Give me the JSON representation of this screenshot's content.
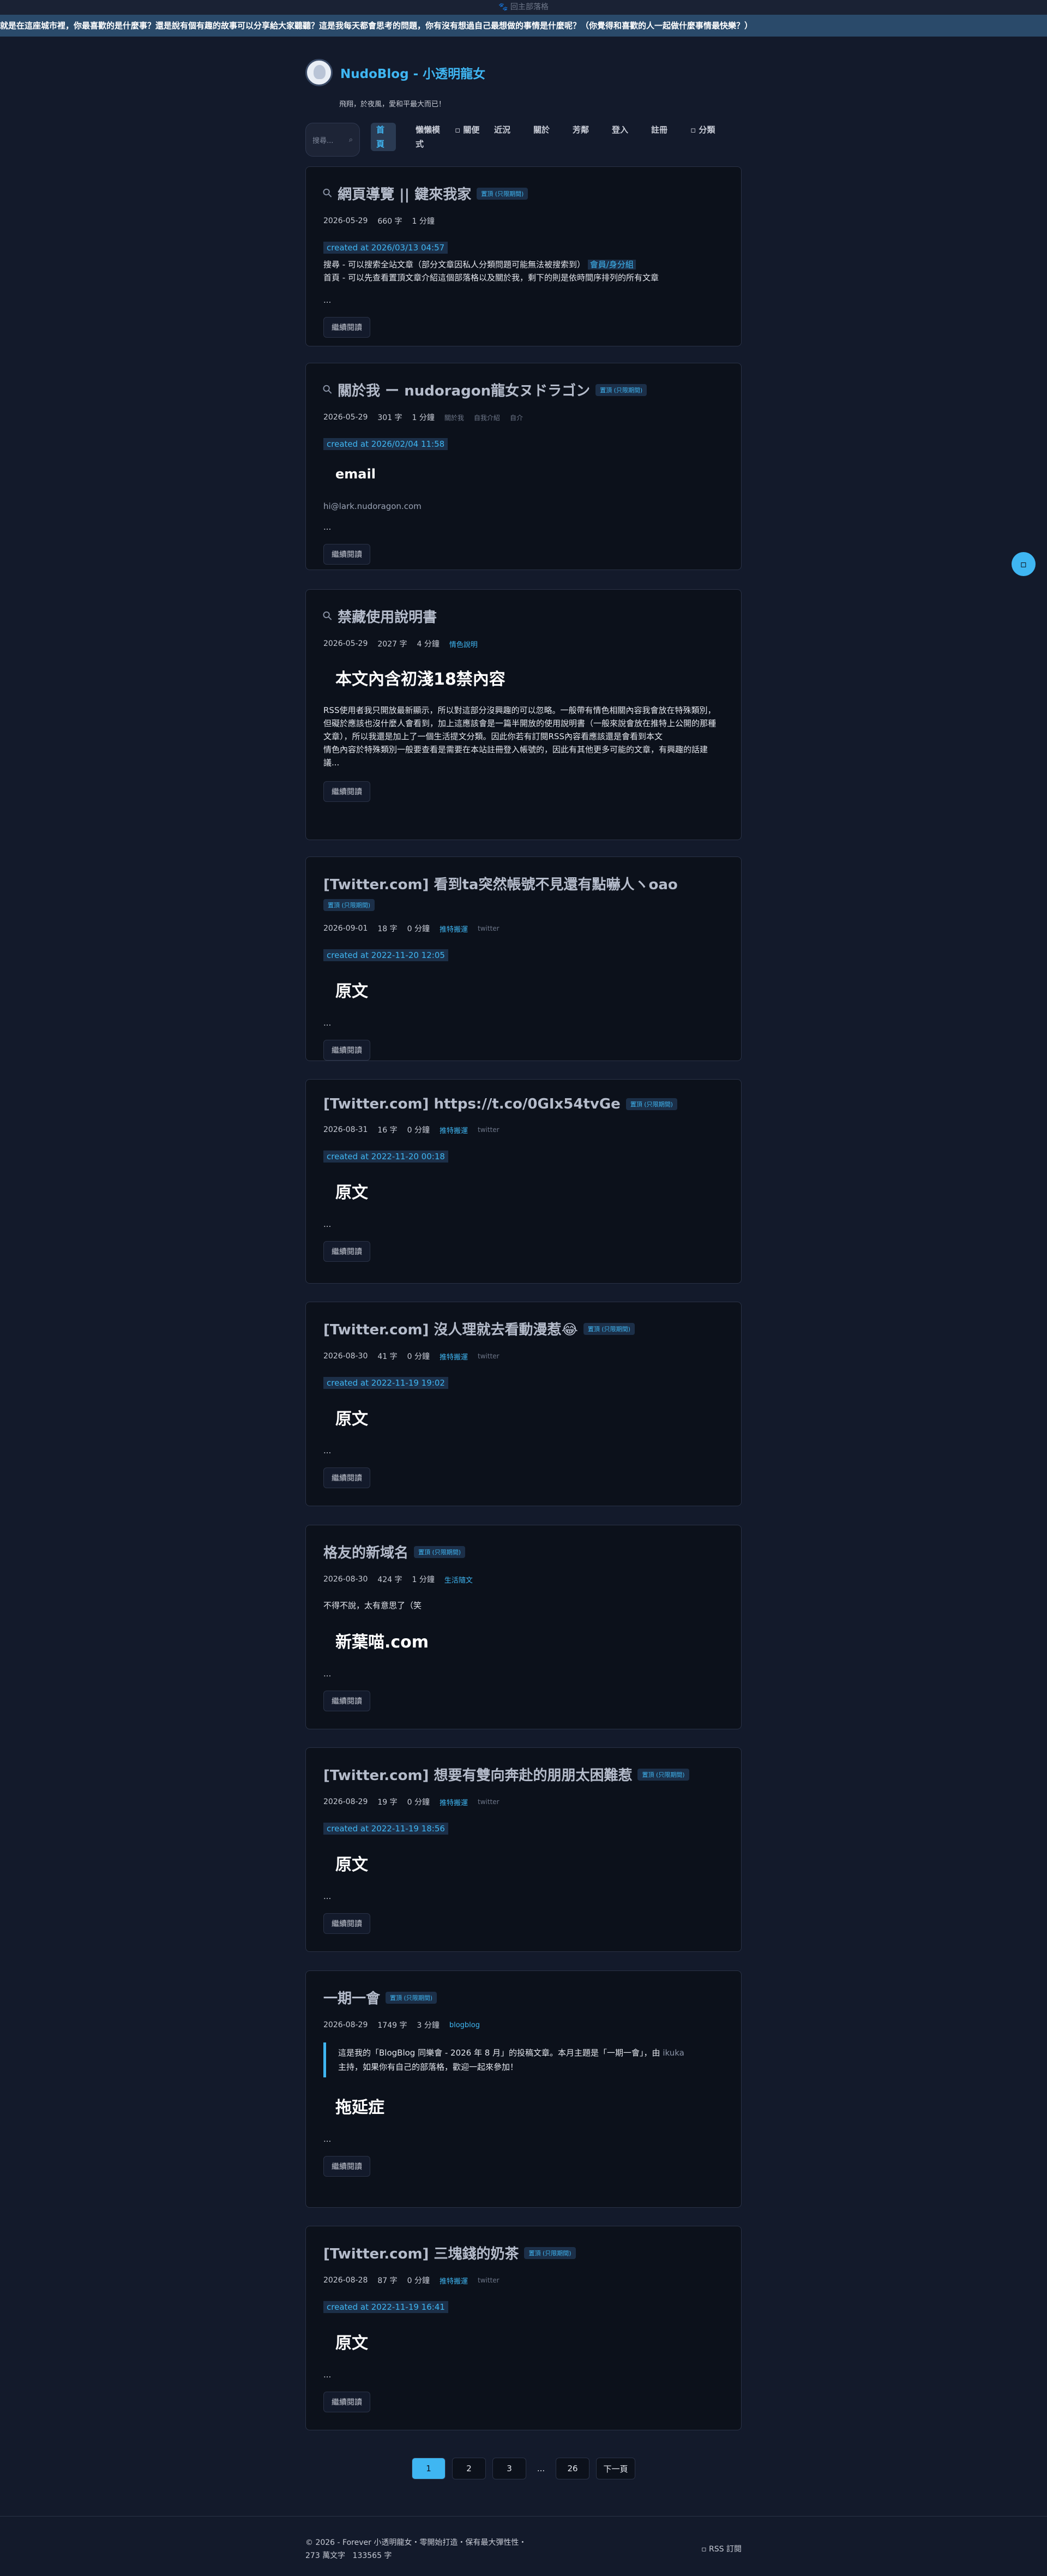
{
  "topbar": {
    "text": "🐾 回主部落格"
  },
  "marquee": {
    "text": "就是在這座城市裡，你最喜歡的是什麼事？還是說有個有趣的故事可以分享給大家聽聽？這是我每天都會思考的問題，你有沒有想過自己最想做的事情是什麼呢？（你覺得和喜歡的人一起做什麼事情最快樂？）"
  },
  "header": {
    "title": "NudoBlog - 小透明龍女",
    "tagline": "飛翔，於夜風，愛和平最大而已！",
    "search_placeholder": "搜尋...",
    "nav": [
      "首頁",
      "懶懶模式",
      "關便",
      "近況",
      "關於",
      "芳鄰",
      "登入",
      "註冊",
      "分類"
    ]
  },
  "posts": [
    {
      "title": "網頁導覽 || 鍵來我家",
      "badge": "置頂 (只限期間)",
      "date": "2026-05-29",
      "words": "660 字",
      "read": "1 分鐘",
      "created": "created at 2026/03/13 04:57",
      "line1": "搜尋 - 可以搜索全站文章（部分文章因私人分類問題可能無法被搜索到）",
      "hl": "會員/身分組",
      "line2": "首頁 - 可以先查看置頂文章介紹這個部落格以及關於我，剩下的則是依時間序排列的所有文章",
      "dots": "...",
      "more": "繼續閱讀"
    },
    {
      "title": "關於我 ー nudoragon龍女ヌドラゴン",
      "badge": "置頂 (只限期間)",
      "date": "2026-05-29",
      "words": "301 字",
      "read": "1 分鐘",
      "tags": [
        "關於我",
        "自我介紹",
        "自介"
      ],
      "created": "created at 2026/02/04 11:58",
      "heading": "email",
      "sub": "hi@lark.nudoragon.com",
      "dots": "...",
      "more": "繼續閱讀"
    },
    {
      "title": "禁藏使用說明書",
      "date": "2026-05-29",
      "words": "2027 字",
      "read": "4 分鐘",
      "tag": "情色說明",
      "heading": "本文內含初淺18禁內容",
      "body": "RSS使用者我只開放最新顯示，所以對這部分沒興趣的可以忽略。一般帶有情色相關內容我會放在特殊類別，但礙於應該也沒什麼人會看到，加上這應該會是一篇半開放的使用說明書（一般來說會放在推特上公開的那種文章），所以我還是加上了一個生活提文分類。因此你若有訂閱RSS內容看應該還是會看到本文",
      "body2": "情色內容於特殊類別一般要查看是需要在本站註冊登入帳號的，因此有其他更多可能的文章，有興趣的話建議...",
      "more": "繼續閱讀"
    },
    {
      "title": "[Twitter.com] 看到ta突然帳號不見還有點嚇人ヽoao",
      "badge": "置頂 (只限期間)",
      "date": "2026-09-01",
      "words": "18 字",
      "read": "0 分鐘",
      "tag": "推特搬運",
      "tag2": "twitter",
      "created": "created at 2022-11-20 12:05",
      "heading": "原文",
      "dots": "...",
      "more": "繼續閱讀"
    },
    {
      "title": "[Twitter.com] https://t.co/0GIx54tvGe",
      "badge": "置頂 (只限期間)",
      "date": "2026-08-31",
      "words": "16 字",
      "read": "0 分鐘",
      "tag": "推特搬運",
      "tag2": "twitter",
      "created": "created at 2022-11-20 00:18",
      "heading": "原文",
      "dots": "...",
      "more": "繼續閱讀"
    },
    {
      "title": "[Twitter.com] 沒人理就去看動漫惹😂",
      "badge": "置頂 (只限期間)",
      "date": "2026-08-30",
      "words": "41 字",
      "read": "0 分鐘",
      "tag": "推特搬運",
      "tag2": "twitter",
      "created": "created at 2022-11-19 19:02",
      "heading": "原文",
      "dots": "...",
      "more": "繼續閱讀"
    },
    {
      "title": "格友的新域名",
      "badge": "置頂 (只限期間)",
      "date": "2026-08-30",
      "words": "424 字",
      "read": "1 分鐘",
      "tag": "生活隨文",
      "line1": "不得不說，太有意思了（笑",
      "heading": "新葉喵.com",
      "dots": "...",
      "more": "繼續閱讀"
    },
    {
      "title": "[Twitter.com] 想要有雙向奔赴的朋朋太困難惹",
      "badge": "置頂 (只限期間)",
      "date": "2026-08-29",
      "words": "19 字",
      "read": "0 分鐘",
      "tag": "推特搬運",
      "tag2": "twitter",
      "created": "created at 2022-11-19 18:56",
      "heading": "原文",
      "dots": "...",
      "more": "繼續閱讀"
    },
    {
      "title": "一期一會",
      "badge": "置頂 (只限期間)",
      "date": "2026-08-29",
      "words": "1749 字",
      "read": "3 分鐘",
      "tag": "blogblog",
      "quote1": "這是我的「BlogBlog 同樂會 - 2026 年 8 月」的投稿文章。本月主題是「一期一會」，由",
      "quote_mut": "ikuka",
      "quote2": "主持，如果你有自己的部落格，歡迎一起來參加！",
      "heading": "拖延症",
      "dots": "...",
      "more": "繼續閱讀"
    },
    {
      "title": "[Twitter.com] 三塊錢的奶茶",
      "badge": "置頂 (只限期間)",
      "date": "2026-08-28",
      "words": "87 字",
      "read": "0 分鐘",
      "tag": "推特搬運",
      "tag2": "twitter",
      "created": "created at 2022-11-19 16:41",
      "heading": "原文",
      "dots": "...",
      "more": "繼續閱讀"
    }
  ],
  "pager": {
    "pages": [
      "1",
      "2",
      "3"
    ],
    "ellipsis": "...",
    "last": "26",
    "next": "下一頁"
  },
  "footer": {
    "copyright": "© 2026 - Forever 小透明龍女・零開始打造・保有最大彈性性・",
    "stats_words": "273 萬文字",
    "stats_views": "133565 字",
    "rss": "RSS 訂閱"
  }
}
